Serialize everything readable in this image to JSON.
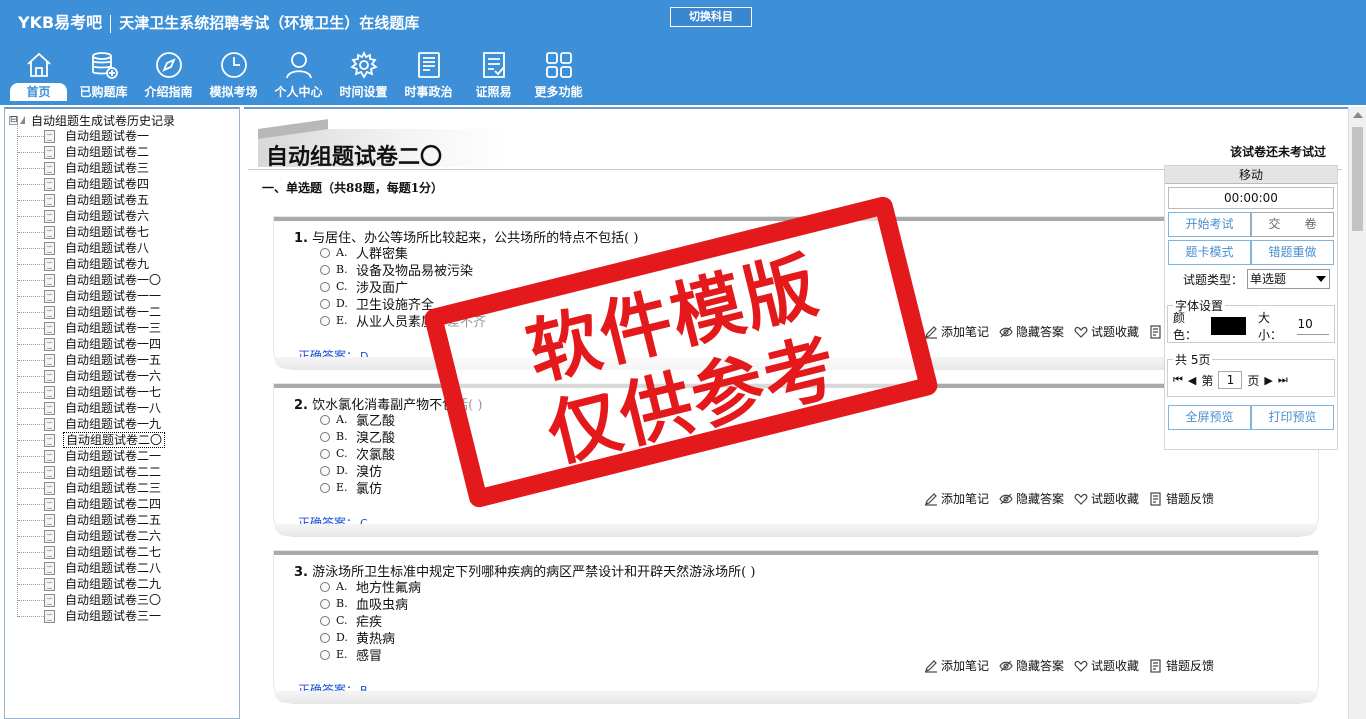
{
  "header": {
    "logo": "YKB易考吧",
    "title": "天津卫生系统招聘考试（环境卫生）在线题库",
    "switch_subject": "切换科目"
  },
  "nav": [
    {
      "label": "首页",
      "icon": "home-icon",
      "active": true
    },
    {
      "label": "已购题库",
      "icon": "database-icon"
    },
    {
      "label": "介绍指南",
      "icon": "compass-icon"
    },
    {
      "label": "模拟考场",
      "icon": "clock-icon"
    },
    {
      "label": "个人中心",
      "icon": "user-icon"
    },
    {
      "label": "时间设置",
      "icon": "gear-icon"
    },
    {
      "label": "时事政治",
      "icon": "news-icon"
    },
    {
      "label": "证照易",
      "icon": "checklist-icon"
    },
    {
      "label": "更多功能",
      "icon": "grid-icon"
    }
  ],
  "tree": {
    "expander": "⊟",
    "root_label": "自动组题生成试卷历史记录",
    "items": [
      "自动组题试卷一",
      "自动组题试卷二",
      "自动组题试卷三",
      "自动组题试卷四",
      "自动组题试卷五",
      "自动组题试卷六",
      "自动组题试卷七",
      "自动组题试卷八",
      "自动组题试卷九",
      "自动组题试卷一〇",
      "自动组题试卷一一",
      "自动组题试卷一二",
      "自动组题试卷一三",
      "自动组题试卷一四",
      "自动组题试卷一五",
      "自动组题试卷一六",
      "自动组题试卷一七",
      "自动组题试卷一八",
      "自动组题试卷一九",
      "自动组题试卷二〇",
      "自动组题试卷二一",
      "自动组题试卷二二",
      "自动组题试卷二三",
      "自动组题试卷二四",
      "自动组题试卷二五",
      "自动组题试卷二六",
      "自动组题试卷二七",
      "自动组题试卷二八",
      "自动组题试卷二九",
      "自动组题试卷三〇",
      "自动组题试卷三一"
    ],
    "selected_index": 19
  },
  "paper": {
    "title": "自动组题试卷二〇",
    "status": "该试卷还未考试过",
    "section": "一、单选题（共88题，每题1分）"
  },
  "actions": {
    "note": "添加笔记",
    "hide": "隐藏答案",
    "favorite": "试题收藏",
    "feedback": "错题反馈"
  },
  "answer_label": "正确答案：",
  "questions": [
    {
      "num": "1.",
      "text": "与居住、办公等场所比较起来，公共场所的特点不包括( )",
      "options": [
        {
          "key": "A.",
          "text": "人群密集"
        },
        {
          "key": "B.",
          "text": "设备及物品易被污染"
        },
        {
          "key": "C.",
          "text": "涉及面广"
        },
        {
          "key": "D.",
          "text": "卫生设施齐全"
        },
        {
          "key": "E.",
          "text": "从业人员素质参差不齐"
        }
      ],
      "answer": "D"
    },
    {
      "num": "2.",
      "text": "饮水氯化消毒副产物不包括( )",
      "options": [
        {
          "key": "A.",
          "text": "氯乙酸"
        },
        {
          "key": "B.",
          "text": "溴乙酸"
        },
        {
          "key": "C.",
          "text": "次氯酸"
        },
        {
          "key": "D.",
          "text": "溴仿"
        },
        {
          "key": "E.",
          "text": "氯仿"
        }
      ],
      "answer": "C"
    },
    {
      "num": "3.",
      "text": "游泳场所卫生标准中规定下列哪种疾病的病区严禁设计和开辟天然游泳场所( )",
      "options": [
        {
          "key": "A.",
          "text": "地方性氟病"
        },
        {
          "key": "B.",
          "text": "血吸虫病"
        },
        {
          "key": "C.",
          "text": "疟疾"
        },
        {
          "key": "D.",
          "text": "黄热病"
        },
        {
          "key": "E.",
          "text": "感冒"
        }
      ],
      "answer": "B"
    }
  ],
  "control": {
    "move": "移动",
    "timer": "00:00:00",
    "start_exam": "开始考试",
    "submit": "交　　卷",
    "card_mode": "题卡模式",
    "redo_wrong": "错题重做",
    "type_label": "试题类型：",
    "type_value": "单选题",
    "font_legend": "字体设置",
    "color_label": "颜色：",
    "color_value": "#000000",
    "size_label": "大小：",
    "size_value": "10",
    "pages_legend": "共 5页",
    "page_prefix": "第",
    "page_value": "1",
    "page_suffix": "页",
    "fullscreen": "全屏预览",
    "print_preview": "打印预览"
  },
  "watermark": {
    "line1": "软件模版",
    "line2": "仅供参考",
    "color": "#e3191c"
  },
  "colors": {
    "header_bg": "#3d8fd8",
    "answer_text": "#1a4fd6"
  }
}
